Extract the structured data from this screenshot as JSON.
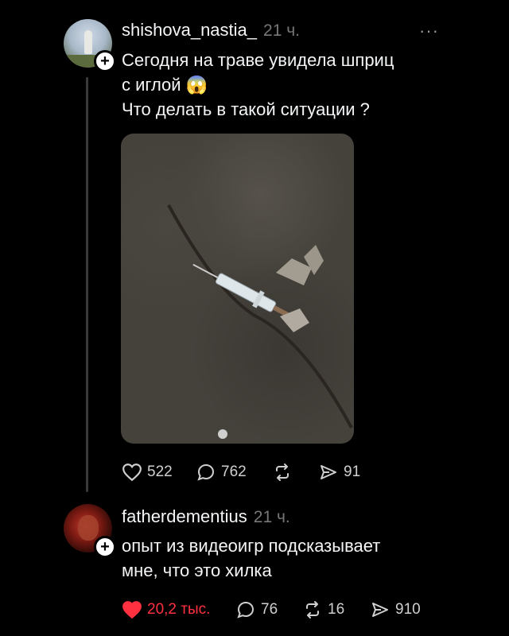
{
  "post": {
    "username": "shishova_nastia_",
    "time": "21 ч.",
    "more": "···",
    "text_line1": "Сегодня на траве увидела шприц",
    "text_line2": "с иглой",
    "text_emoji": "😱",
    "text_line3": "Что делать в такой ситуации ?",
    "stats": {
      "likes": "522",
      "comments": "762",
      "reposts": "",
      "shares": "91"
    }
  },
  "reply": {
    "username": "fatherdementius",
    "time": "21 ч.",
    "text_line1": "опыт из видеоигр подсказывает",
    "text_line2": "мне, что это хилка",
    "stats": {
      "likes": "20,2 тыс.",
      "comments": "76",
      "reposts": "16",
      "shares": "910"
    }
  },
  "icons": [
    "heart-icon",
    "comment-icon",
    "repost-icon",
    "share-icon",
    "plus-icon",
    "more-icon"
  ],
  "colors": {
    "like_red": "#ff3040",
    "background": "#000000"
  }
}
